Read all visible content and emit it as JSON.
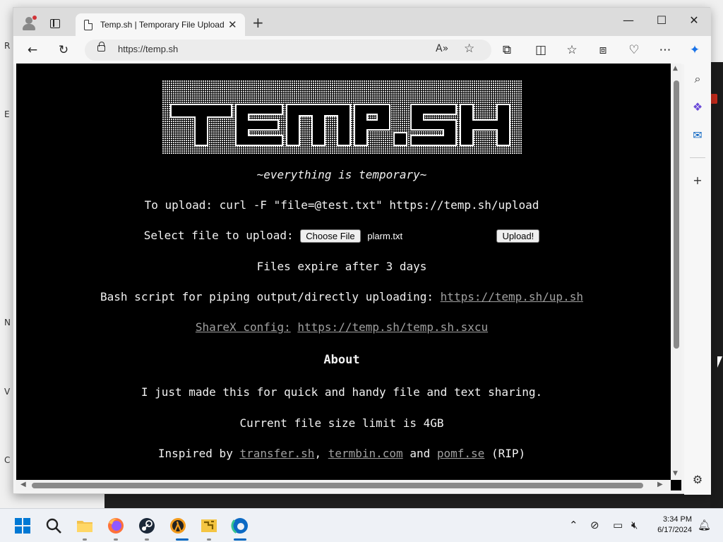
{
  "browser": {
    "tab_title": "Temp.sh | Temporary File Upload",
    "url": "https://temp.sh",
    "reader_label": "A»"
  },
  "page": {
    "logo_text": "TEMP.SH",
    "tagline": "~everything is temporary~",
    "upload_cmd": "To upload: curl -F \"file=@test.txt\" https://temp.sh/upload",
    "select_label": "Select file to upload:",
    "choose_file_label": "Choose File",
    "chosen_file": "plarm.txt",
    "upload_button": "Upload!",
    "expiry": "Files expire after 3 days",
    "bash_label": "Bash script for piping output/directly uploading:",
    "bash_link": "https://temp.sh/up.sh",
    "sharex_label": "ShareX config:",
    "sharex_link": "https://temp.sh/temp.sh.sxcu",
    "about_heading": "About",
    "about_text": "I just made this for quick and handy file and text sharing.",
    "size_limit": "Current file size limit is 4GB",
    "inspired_prefix": "Inspired by",
    "inspired_link1": "transfer.sh",
    "inspired_sep": ",",
    "inspired_link2": "termbin.com",
    "inspired_and": "and",
    "inspired_link3": "pomf.se",
    "inspired_suffix": "(RIP)"
  },
  "taskbar": {
    "time": "3:34 PM",
    "date": "6/17/2024",
    "apps": [
      "start-icon",
      "search-icon",
      "file-explorer-icon",
      "firefox-icon",
      "steam-icon",
      "half-life-icon",
      "puzzle-app-icon",
      "edge-icon"
    ]
  },
  "desktop_letters": [
    "R",
    "E",
    "N",
    "V",
    "C"
  ],
  "colors": {
    "page_bg": "#000000",
    "page_text": "#f2f2f2",
    "link": "#a0a0a0",
    "edge_blue": "#0c6ac4"
  }
}
